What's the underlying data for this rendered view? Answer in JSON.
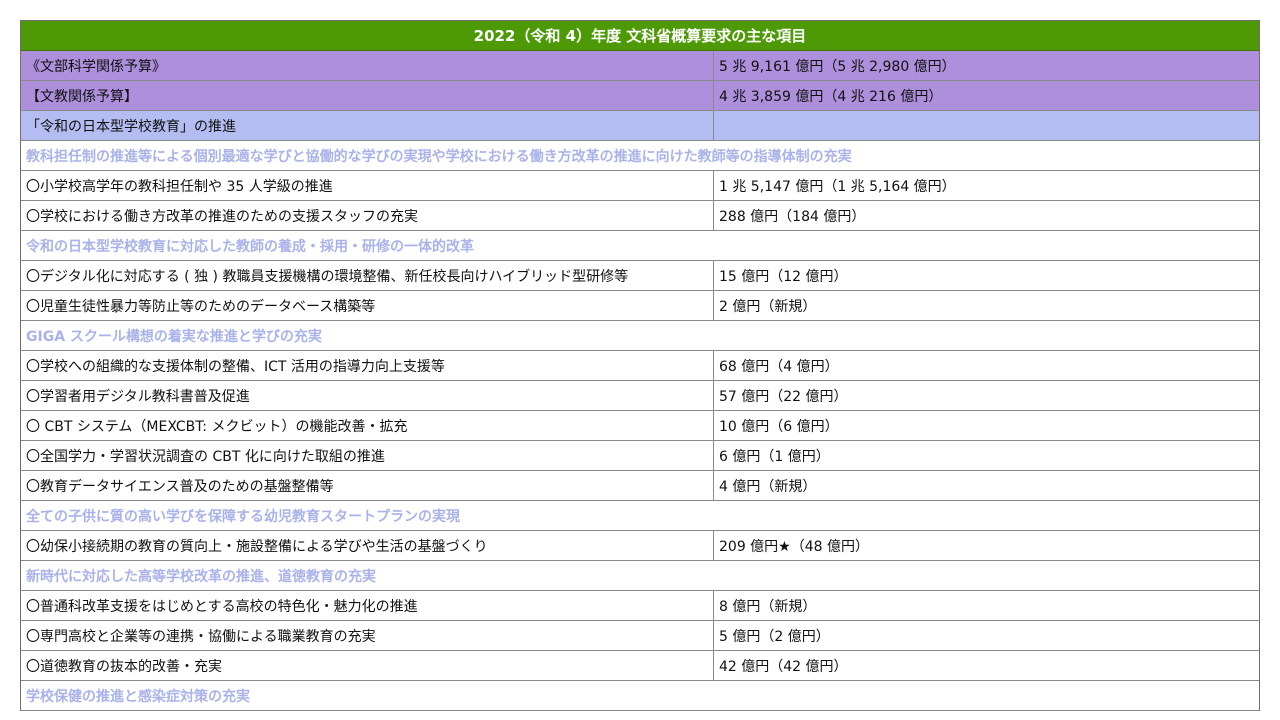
{
  "title": "2022（令和 4）年度 文科省概算要求の主な項目",
  "rows": [
    {
      "kind": "purple",
      "item": "《文部科学関係予算》",
      "amount": "5 兆 9,161 億円（5 兆 2,980 億円）"
    },
    {
      "kind": "purple",
      "item": "【文教関係予算】",
      "amount": "4 兆 3,859 億円（4 兆 216 億円）"
    },
    {
      "kind": "blue",
      "item": "「令和の日本型学校教育」の推進",
      "amount": ""
    },
    {
      "kind": "section",
      "item": "教科担任制の推進等による個別最適な学びと協働的な学びの実現や学校における働き方改革の推進に向けた教師等の指導体制の充実"
    },
    {
      "kind": "item",
      "item": "〇小学校高学年の教科担任制や 35 人学級の推進",
      "amount": "1 兆 5,147 億円（1 兆 5,164 億円）"
    },
    {
      "kind": "item",
      "item": "〇学校における働き方改革の推進のための支援スタッフの充実",
      "amount": "288 億円（184 億円）"
    },
    {
      "kind": "section",
      "item": "令和の日本型学校教育に対応した教師の養成・採用・研修の一体的改革"
    },
    {
      "kind": "item",
      "item": "〇デジタル化に対応する ( 独 ) 教職員支援機構の環境整備、新任校長向けハイブリッド型研修等",
      "amount": "15 億円（12 億円）"
    },
    {
      "kind": "item",
      "item": "〇児童生徒性暴力等防止等のためのデータベース構築等",
      "amount": "2 億円（新規）"
    },
    {
      "kind": "section",
      "item": "GIGA スクール構想の着実な推進と学びの充実"
    },
    {
      "kind": "item",
      "item": "〇学校への組織的な支援体制の整備、ICT 活用の指導力向上支援等",
      "amount": "68 億円（4 億円）"
    },
    {
      "kind": "item",
      "item": "〇学習者用デジタル教科書普及促進",
      "amount": "57 億円（22 億円）"
    },
    {
      "kind": "item",
      "item": "〇 CBT システム（MEXCBT: メクビット）の機能改善・拡充",
      "amount": "10 億円（6 億円）"
    },
    {
      "kind": "item",
      "item": "〇全国学力・学習状況調査の CBT 化に向けた取組の推進",
      "amount": "6 億円（1 億円）"
    },
    {
      "kind": "item",
      "item": "〇教育データサイエンス普及のための基盤整備等",
      "amount": "4 億円（新規）"
    },
    {
      "kind": "section",
      "item": "全ての子供に質の高い学びを保障する幼児教育スタートプランの実現"
    },
    {
      "kind": "item",
      "item": "〇幼保小接続期の教育の質向上・施設整備による学びや生活の基盤づくり",
      "amount": "209 億円★（48 億円）"
    },
    {
      "kind": "section",
      "item": "新時代に対応した高等学校改革の推進、道徳教育の充実"
    },
    {
      "kind": "item",
      "item": "〇普通科改革支援をはじめとする高校の特色化・魅力化の推進",
      "amount": "8 億円（新規）"
    },
    {
      "kind": "item",
      "item": "〇専門高校と企業等の連携・協働による職業教育の充実",
      "amount": "5 億円（2 億円）"
    },
    {
      "kind": "item",
      "item": "〇道徳教育の抜本的改善・充実",
      "amount": "42 億円（42 億円）"
    },
    {
      "kind": "section",
      "item": "学校保健の推進と感染症対策の充実"
    }
  ]
}
